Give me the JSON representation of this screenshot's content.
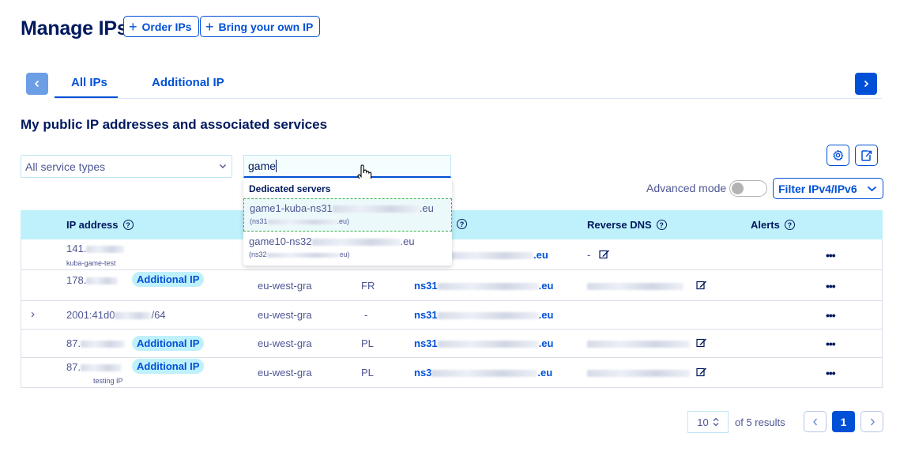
{
  "header": {
    "title": "Manage IPs",
    "order_label": "Order IPs",
    "byoip_label": "Bring your own IP"
  },
  "tabs": [
    {
      "label": "All IPs",
      "active": true
    },
    {
      "label": "Additional IP",
      "active": false
    }
  ],
  "section_title": "My public IP addresses and associated services",
  "filters": {
    "service_type": "All service types",
    "search_value": "game",
    "advanced_mode_label": "Advanced mode",
    "advanced_mode_on": false,
    "filter_ip_label": "Filter IPv4/IPv6"
  },
  "autocomplete": {
    "group": "Dedicated servers",
    "items": [
      {
        "name_prefix": "game1-kuba-ns31",
        "name_suffix": ".eu",
        "sub_prefix": "(ns31",
        "sub_suffix": ".eu)"
      },
      {
        "name_prefix": "game10-ns32",
        "name_suffix": ".eu",
        "sub_prefix": "(ns32",
        "sub_suffix": "eu)"
      }
    ]
  },
  "table": {
    "headers": {
      "ip": "IP address",
      "reverse": "Reverse DNS",
      "alerts": "Alerts"
    },
    "rows": [
      {
        "ip": "141.",
        "sub": "kuba-game-test",
        "badge": "",
        "region": "",
        "country": "",
        "service_prefix": "",
        "service_suffix": ".eu",
        "reverse": "-"
      },
      {
        "ip": "178.",
        "sub": "",
        "badge": "Additional IP",
        "region": "eu-west-gra",
        "country": "FR",
        "service_prefix": "ns31",
        "service_suffix": ".eu",
        "reverse": ""
      },
      {
        "ip": "2001:41d0",
        "ip_suffix": "/64",
        "sub": "",
        "badge": "",
        "region": "eu-west-gra",
        "country": "-",
        "service_prefix": "ns31",
        "service_suffix": ".eu",
        "reverse": ""
      },
      {
        "ip": "87.",
        "sub": "",
        "badge": "Additional IP",
        "region": "eu-west-gra",
        "country": "PL",
        "service_prefix": "ns31",
        "service_suffix": ".eu",
        "reverse": ""
      },
      {
        "ip": "87.",
        "sub": "testing IP",
        "badge": "Additional IP",
        "region": "eu-west-gra",
        "country": "PL",
        "service_prefix": "ns3",
        "service_suffix": ".eu",
        "reverse": ""
      }
    ],
    "row_actions": "•••",
    "expand_icon": "›"
  },
  "pagination": {
    "page_size": "10",
    "results_text": "of 5 results",
    "current_page": "1"
  },
  "colors": {
    "primary": "#0050d7",
    "header_bg": "#bef1fb",
    "title": "#00185e"
  }
}
